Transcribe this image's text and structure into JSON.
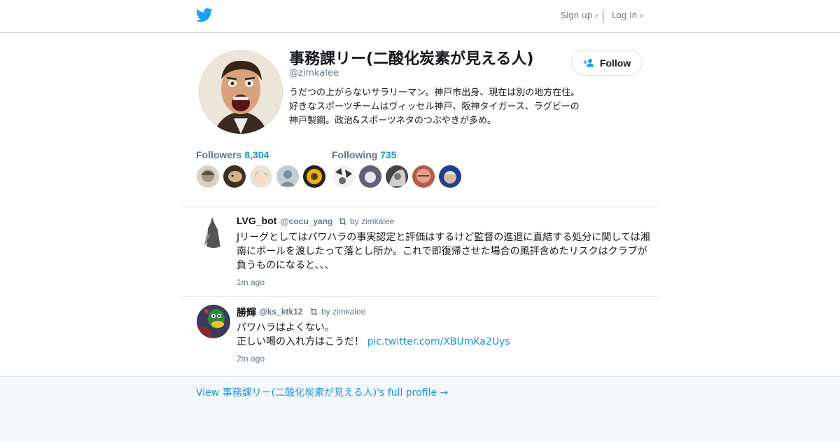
{
  "header": {
    "signup_label": "Sign up ›",
    "login_label": "Log in ›"
  },
  "profile": {
    "name": "事務課リー(二酸化炭素が見える人)",
    "handle": "@zimkalee",
    "bio": "うだつの上がらないサラリーマン。神戸市出身、現在は別の地方在住。好きなスポーツチームはヴィッセル神戸、阪神タイガース、ラグビーの神戸製鋼。政治&スポーツネタのつぶやきが多め。",
    "follow_label": "Follow"
  },
  "stats": {
    "followers_label": "Followers",
    "followers_count": "8,304",
    "following_label": "Following",
    "following_count": "735"
  },
  "tweets": [
    {
      "name": "LVG_bot",
      "handle": "@cocu_yang",
      "retweeted_by": "by zimkalee",
      "text": "Jリーグとしてはパワハラの事実認定と評価はするけど監督の進退に直結する処分に関しては湘南にボールを渡したって落とし所か。これで即復帰させた場合の風評含めたリスクはクラブが負うものになると、、、",
      "time": "1m ago"
    },
    {
      "name": "勝輝",
      "handle": "@ks_ktk12",
      "retweeted_by": "by zimkalee",
      "text_line1": "パワハラはよくない。",
      "text_line2": "正しい喝の入れ方はこうだ！",
      "link": "pic.twitter.com/XBUmKa2Uys",
      "time": "2m ago"
    }
  ],
  "footer": {
    "full_profile_link": "View 事務課リー(二酸化炭素が見える人)'s full profile →"
  },
  "colors": {
    "accent": "#1b95e0",
    "twitter_blue": "#1da1f2",
    "muted": "#657786",
    "footer_bg": "#f5f8fa"
  }
}
